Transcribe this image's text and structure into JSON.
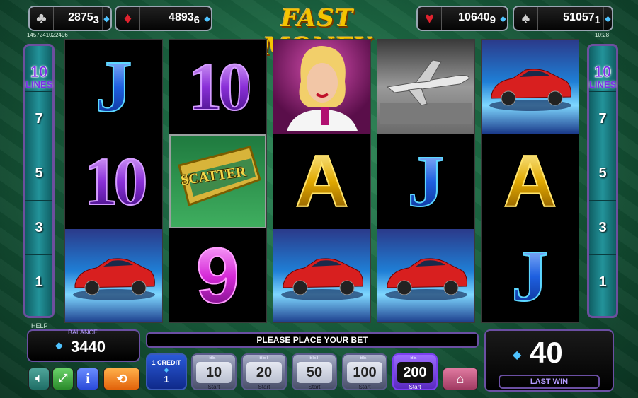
{
  "title": "FAST MONEY",
  "jackpots": [
    {
      "suit": "clubs",
      "glyph": "♣",
      "value": "2875",
      "sub": "3",
      "color": "#cfcfcf"
    },
    {
      "suit": "diamonds",
      "glyph": "♦",
      "value": "4893",
      "sub": "6",
      "color": "#e0222e"
    },
    {
      "suit": "hearts",
      "glyph": "♥",
      "value": "10640",
      "sub": "9",
      "color": "#e0222e"
    },
    {
      "suit": "spades",
      "glyph": "♠",
      "value": "51057",
      "sub": "1",
      "color": "#cfcfcf"
    }
  ],
  "session_id": "1457241022496",
  "clock": "10:28",
  "lines": {
    "count": "10",
    "label": "LINES",
    "markers": [
      "7",
      "5",
      "3",
      "1"
    ]
  },
  "reels": [
    [
      "J",
      "10",
      "car"
    ],
    [
      "10",
      "scatter",
      "9"
    ],
    [
      "lady",
      "A",
      "car"
    ],
    [
      "jet",
      "J",
      "car"
    ],
    [
      "car",
      "A",
      "J"
    ]
  ],
  "scatter_label": "SCATTER",
  "help_label": "HELP",
  "balance": {
    "label": "BALANCE",
    "value": "3440"
  },
  "message": "PLEASE PLACE YOUR BET",
  "credit": {
    "label": "1 CREDIT",
    "value": "1"
  },
  "bets": [
    {
      "top": "BET",
      "value": "10",
      "start": "Start",
      "selected": false
    },
    {
      "top": "BET",
      "value": "20",
      "start": "Start",
      "selected": false
    },
    {
      "top": "BET",
      "value": "50",
      "start": "Start",
      "selected": false
    },
    {
      "top": "BET",
      "value": "100",
      "start": "Start",
      "selected": false
    },
    {
      "top": "BET",
      "value": "200",
      "start": "Start",
      "selected": true
    }
  ],
  "last_win": {
    "value": "40",
    "label": "LAST WIN"
  },
  "icons": {
    "sound": "speaker-icon",
    "fullscreen": "fullscreen-icon",
    "info": "info-icon",
    "autoplay": "autoplay-icon",
    "home": "home-icon",
    "diamond": "diamond-currency-icon"
  },
  "colors": {
    "accent": "#6b4fa3",
    "logo": "#f5c400",
    "selected_bet": "#7b3ff0"
  }
}
